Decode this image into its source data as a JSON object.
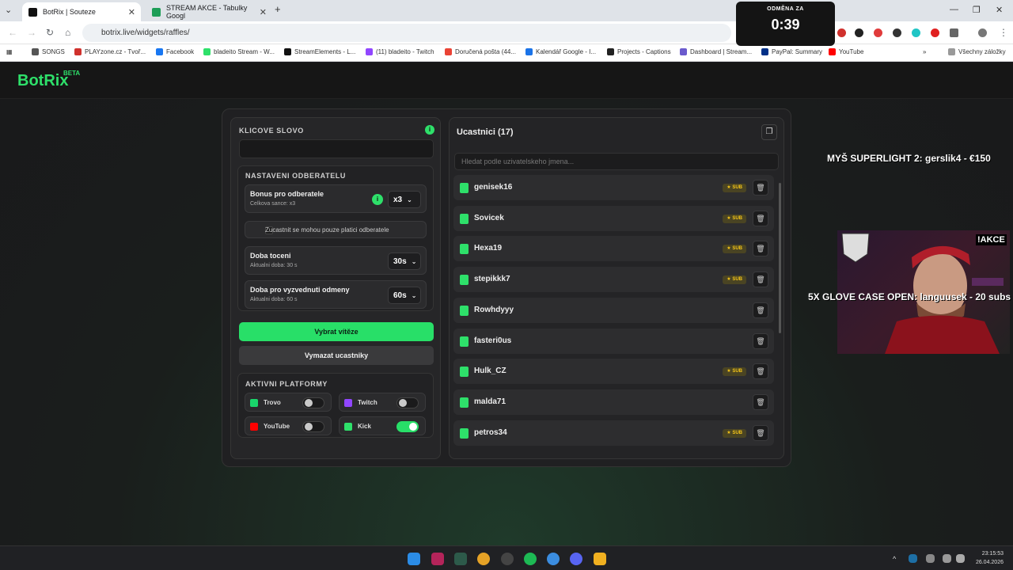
{
  "browser": {
    "tabs": [
      {
        "title": "BotRix | Souteze",
        "color": "#111111"
      },
      {
        "title": "STREAM AKCE - Tabulky Googl",
        "color": "#1e9e57"
      }
    ],
    "new_tab": "+",
    "url": "botrix.live/widgets/raffles/",
    "bookmarks": [
      {
        "label": "SONGS",
        "color": "#555555"
      },
      {
        "label": "PLAYzone.cz - Tvoř...",
        "color": "#d0312d"
      },
      {
        "label": "Facebook",
        "color": "#1877f2"
      },
      {
        "label": "bladeito Stream - W...",
        "color": "#2ee06a"
      },
      {
        "label": "StreamElements - L...",
        "color": "#111111"
      },
      {
        "label": "(11) bladeito - Twitch",
        "color": "#9146ff"
      },
      {
        "label": "Doručená pošta (44...",
        "color": "#ea4335"
      },
      {
        "label": "Kalendář Google - I...",
        "color": "#1a73e8"
      },
      {
        "label": "Projects - Captions",
        "color": "#222222"
      },
      {
        "label": "Dashboard | Stream...",
        "color": "#6a5acd"
      },
      {
        "label": "PayPal: Summary",
        "color": "#003087"
      },
      {
        "label": "YouTube",
        "color": "#ff0000"
      }
    ],
    "bookmarks_more": "»",
    "all_bookmarks": "Všechny záložky"
  },
  "timer": {
    "label": "ODMĚNA ZA",
    "value": "0:39"
  },
  "app": {
    "logo": "BotRix",
    "logo_badge": "BETA"
  },
  "left": {
    "keyword_title": "KLICOVE SLOVO",
    "keyword_value": "",
    "subs_title": "NASTAVENI ODBERATELU",
    "bonus_label": "Bonus pro odberatele",
    "bonus_sub": "Celkova sance: x3",
    "bonus_value": "x3",
    "only_subs_label": "Zucastnit se mohou pouze platici odberatele",
    "spin_label": "Doba toceni",
    "spin_sub": "Aktualni doba: 30 s",
    "spin_value": "30s",
    "claim_label": "Doba pro vyzvednuti odmeny",
    "claim_sub": "Aktualni doba: 60 s",
    "claim_value": "60s",
    "pick_button": "Vybrat vítěze",
    "clear_button": "Vymazat ucastniky",
    "platforms_title": "AKTIVNI PLATFORMY",
    "platforms": [
      {
        "name": "Trovo",
        "on": false,
        "color": "#19d66b"
      },
      {
        "name": "Twitch",
        "on": false,
        "color": "#9146ff"
      },
      {
        "name": "YouTube",
        "on": false,
        "color": "#ff0000"
      },
      {
        "name": "Kick",
        "on": true,
        "color": "#2ee06a"
      }
    ]
  },
  "right": {
    "title": "Ucastnici (17)",
    "search_placeholder": "Hledat podle uzivatelskeho jmena...",
    "sub_badge": "★ SUB",
    "participants": [
      {
        "name": "genisek16",
        "sub": true
      },
      {
        "name": "Sovicek",
        "sub": true
      },
      {
        "name": "Hexa19",
        "sub": true
      },
      {
        "name": "stepikkk7",
        "sub": true
      },
      {
        "name": "Rowhdyyy",
        "sub": false
      },
      {
        "name": "fasteri0us",
        "sub": false
      },
      {
        "name": "Hulk_CZ",
        "sub": true
      },
      {
        "name": "malda71",
        "sub": false
      },
      {
        "name": "petros34",
        "sub": true
      }
    ]
  },
  "overlay": {
    "top_text": "MYŠ SUPERLIGHT 2: gerslik4 - €150",
    "akce": "!AKCE",
    "bottom_text": "5X GLOVE CASE OPEN: languusek - 20 subs"
  },
  "taskbar": {
    "time": "23:15:53",
    "date": "26.04.2026"
  }
}
